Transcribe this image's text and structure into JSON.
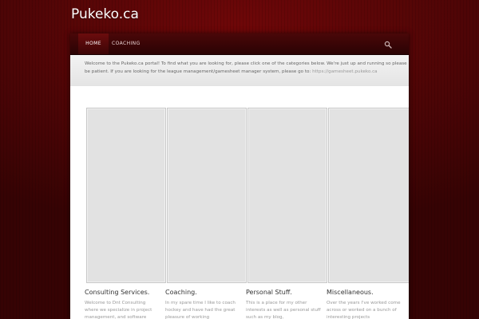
{
  "site": {
    "title": "Pukeko.ca"
  },
  "nav": {
    "items": [
      {
        "label": "HOME",
        "active": true
      },
      {
        "label": "COACHING",
        "active": false
      }
    ],
    "search_icon": "magnifier-icon"
  },
  "welcome": {
    "text": "Welcome to the Pukeko.ca portal! To find what you are looking for, please click one of the categories below. We're just up and running so please be patient. If you are looking for the league management/gamesheet manager system, please go to: ",
    "link": "https://gamesheet.pukeko.ca"
  },
  "columns": [
    {
      "title": "Consulting Services.",
      "text": "Welcome to Dnt Consulting where we specialize in project management, and software"
    },
    {
      "title": "Coaching.",
      "text": "In my spare time I like to coach hockey and have had the great pleasure of working"
    },
    {
      "title": "Personal Stuff.",
      "text": "This is a place for my other interests as well as personal stuff such as my blog,"
    },
    {
      "title": "Miscellaneous.",
      "text": "Over the years I've worked come across or worked on a bunch of interesting projects"
    }
  ],
  "colors": {
    "background": "#4e0506",
    "navbar": "#2a0304",
    "tile": "#e2e2e2",
    "title_text": "#333333",
    "body_text": "#999999"
  }
}
